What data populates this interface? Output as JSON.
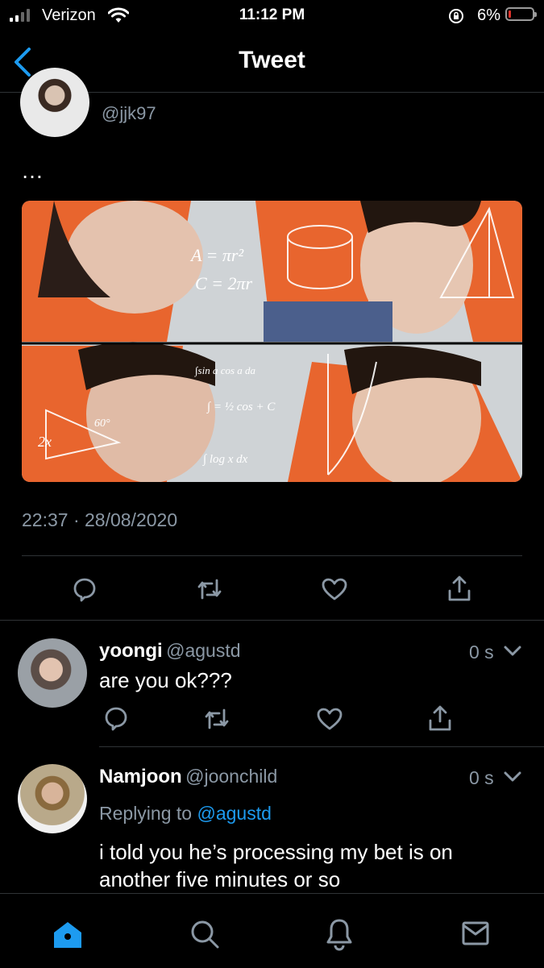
{
  "status_bar": {
    "carrier": "Verizon",
    "time": "11:12 PM",
    "battery_percent": "6%",
    "battery_level": 0.06,
    "battery_color": "#e0332b"
  },
  "header": {
    "title": "Tweet",
    "back_icon": "chevron-left-icon"
  },
  "main_tweet": {
    "handle": "@jjk97",
    "text": "…",
    "image_description_icon": "photo",
    "timestamp": "22:37 · 28/08/2020",
    "actions": [
      "reply-icon",
      "retweet-icon",
      "like-icon",
      "share-icon"
    ]
  },
  "replies": [
    {
      "name": "yoongi",
      "handle": "@agustd",
      "time": "0 s",
      "text": "are you ok???"
    },
    {
      "name": "Namjoon",
      "handle": "@joonchild",
      "time": "0 s",
      "replying_prefix": "Replying to",
      "replying_to": "@agustd",
      "text_line1": "i told you he’s processing my bet is on",
      "text_line2": "another five minutes or so"
    }
  ],
  "tab_bar": {
    "items": [
      "home-icon",
      "search-icon",
      "notifications-icon",
      "messages-icon"
    ],
    "active_color": "#1d9bf0"
  }
}
